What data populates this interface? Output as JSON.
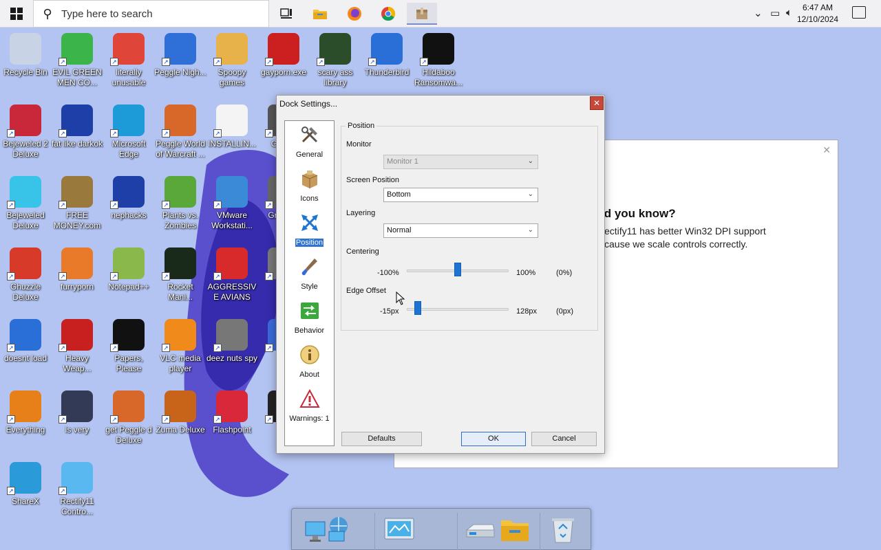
{
  "taskbar": {
    "search_placeholder": "Type here to search",
    "time": "6:47 AM",
    "date": "12/10/2024",
    "pinned": [
      {
        "icon": "task-view-icon"
      },
      {
        "icon": "file-explorer-icon"
      },
      {
        "icon": "firefox-icon"
      },
      {
        "icon": "chrome-icon"
      },
      {
        "icon": "package-app-icon"
      }
    ]
  },
  "desktop": {
    "icons": [
      {
        "label": "Recycle Bin",
        "icon": "recycle-bin-icon",
        "color": "#c8d4e6"
      },
      {
        "label": "EVIL GREEN MEN CO...",
        "icon": "green-men-icon",
        "color": "#3bb54a"
      },
      {
        "label": "literally unusable",
        "icon": "chrome-icon",
        "color": "#e0453a"
      },
      {
        "label": "Peggle Nigh...",
        "icon": "peggle-icon",
        "color": "#2e6fd8"
      },
      {
        "label": "Spoopy games",
        "icon": "folder-icon",
        "color": "#e8b24a"
      },
      {
        "label": "gayporn.exe",
        "icon": "flash-icon",
        "color": "#cc1f1f"
      },
      {
        "label": "scary ass library",
        "icon": "library-icon",
        "color": "#2c4d2a"
      },
      {
        "label": "Thunderbird",
        "icon": "thunderbird-icon",
        "color": "#2a6fd8"
      },
      {
        "label": "Hildaboo Ransomwa...",
        "icon": "yashma-icon",
        "color": "#111111"
      },
      {
        "label": "Bejeweled 2 Deluxe",
        "icon": "bejeweled2-icon",
        "color": "#c8283a"
      },
      {
        "label": "fat like darkok",
        "icon": "mpi-icon",
        "color": "#1f3fa8"
      },
      {
        "label": "Microsoft Edge",
        "icon": "edge-icon",
        "color": "#1c9bd8"
      },
      {
        "label": "Peggle World of Warcraft ...",
        "icon": "peggle-wow-icon",
        "color": "#d8682a"
      },
      {
        "label": "INSTALLIN...",
        "icon": "text-file-icon",
        "color": "#f4f4f4"
      },
      {
        "label": "G THE",
        "icon": "partial-icon",
        "color": "#555555"
      },
      {
        "label": "Bejeweled Deluxe",
        "icon": "bejeweled-icon",
        "color": "#38c4e8"
      },
      {
        "label": "FREE MONEY.com",
        "icon": "money-bag-icon",
        "color": "#9a7a3c"
      },
      {
        "label": "nephacks",
        "icon": "mpi-icon",
        "color": "#1f3fa8"
      },
      {
        "label": "Plants vs. Zombies",
        "icon": "pvz-icon",
        "color": "#5aa83a"
      },
      {
        "label": "VMware Workstati...",
        "icon": "vmware-icon",
        "color": "#3a8ad8"
      },
      {
        "label": "Gra Part",
        "icon": "partial-icon",
        "color": "#666666"
      },
      {
        "label": "Ghuzzle Deluxe",
        "icon": "ghuzzle-icon",
        "color": "#d83a2a"
      },
      {
        "label": "furryporn",
        "icon": "firefox-icon",
        "color": "#e87a2a"
      },
      {
        "label": "Notepad++",
        "icon": "notepadpp-icon",
        "color": "#8ab84a"
      },
      {
        "label": "Rocket Mani...",
        "icon": "rocket-icon",
        "color": "#1a2a1a"
      },
      {
        "label": "AGGRESSIVE AVIANS",
        "icon": "angry-birds-icon",
        "color": "#d82a2a"
      },
      {
        "label": "Hal",
        "icon": "partial-icon",
        "color": "#777777"
      },
      {
        "label": "doesnt load",
        "icon": "thunderbird-icon",
        "color": "#2a6fd8"
      },
      {
        "label": "Heavy Weap...",
        "icon": "radiation-icon",
        "color": "#c81f1f"
      },
      {
        "label": "Papers, Please",
        "icon": "papers-please-icon",
        "color": "#111111"
      },
      {
        "label": "VLC media player",
        "icon": "vlc-icon",
        "color": "#f08a1a"
      },
      {
        "label": "deez nuts spy",
        "icon": "windows-stack-icon",
        "color": "#777777"
      },
      {
        "label": "Ba",
        "icon": "partial-icon",
        "color": "#3a6ad8"
      },
      {
        "label": "Everything",
        "icon": "search-orange-icon",
        "color": "#e8801a"
      },
      {
        "label": "is very",
        "icon": "mpi-shield-icon",
        "color": "#333a55"
      },
      {
        "label": "get Peggle d Deluxe",
        "icon": "peggle-icon",
        "color": "#d8682a"
      },
      {
        "label": "Zuma Deluxe",
        "icon": "zuma-icon",
        "color": "#c8641a"
      },
      {
        "label": "Flashpoint",
        "icon": "flashpoint-icon",
        "color": "#d8283a"
      },
      {
        "label": "RD",
        "icon": "partial-icon",
        "color": "#222222"
      },
      {
        "label": "ShareX",
        "icon": "sharex-icon",
        "color": "#2a9ad8"
      },
      {
        "label": "Rectify11 Contro...",
        "icon": "rectify-icon",
        "color": "#5ab8f0"
      }
    ]
  },
  "rectify_window": {
    "heading": "id you know?",
    "body": "ectify11 has better Win32 DPI support cause we scale controls correctly."
  },
  "dialog": {
    "title": "Dock Settings...",
    "nav": [
      {
        "label": "General",
        "icon": "tools-icon"
      },
      {
        "label": "Icons",
        "icon": "box-icon"
      },
      {
        "label": "Position",
        "icon": "position-arrows-icon"
      },
      {
        "label": "Style",
        "icon": "brush-icon"
      },
      {
        "label": "Behavior",
        "icon": "behavior-arrows-icon"
      },
      {
        "label": "About",
        "icon": "info-icon"
      },
      {
        "label": "Warnings: 1",
        "icon": "warning-icon"
      }
    ],
    "selected_nav": "Position",
    "group_title": "Position",
    "monitor": {
      "label": "Monitor",
      "value": "Monitor 1"
    },
    "screen_position": {
      "label": "Screen Position",
      "value": "Bottom"
    },
    "layering": {
      "label": "Layering",
      "value": "Normal"
    },
    "centering": {
      "label": "Centering",
      "min": "-100%",
      "max": "100%",
      "current": "(0%)",
      "fraction": 0.5
    },
    "edge_offset": {
      "label": "Edge Offset",
      "min": "-15px",
      "max": "128px",
      "current": "(0px)",
      "fraction": 0.105
    },
    "buttons": {
      "defaults": "Defaults",
      "ok": "OK",
      "cancel": "Cancel"
    }
  },
  "dock": {
    "items": [
      {
        "icon": "network-computers-icon"
      },
      {
        "icon": "control-panel-icon"
      },
      {
        "icon": "drive-icon"
      },
      {
        "icon": "folder-icon"
      },
      {
        "icon": "recycle-bin-icon"
      }
    ]
  }
}
